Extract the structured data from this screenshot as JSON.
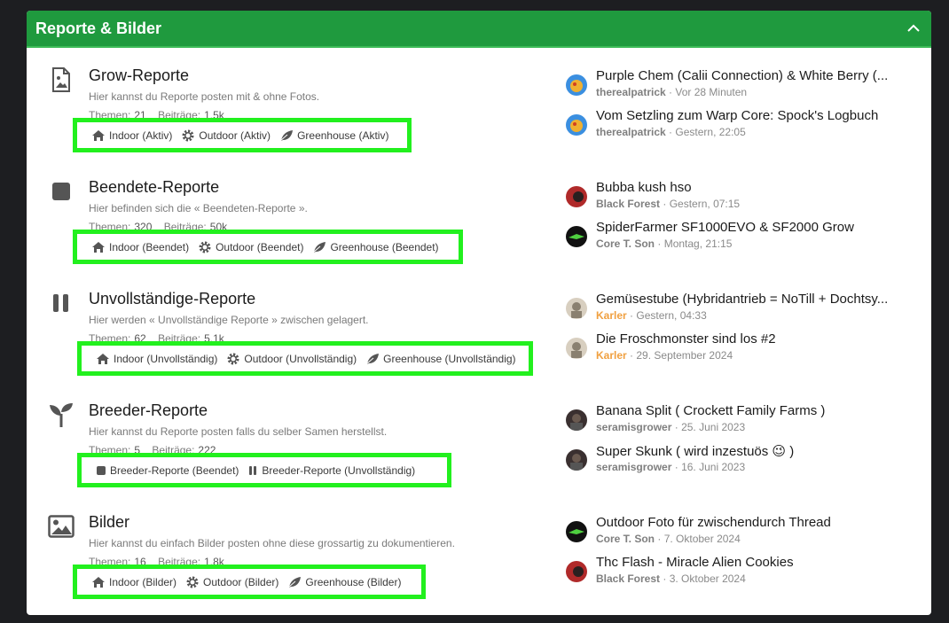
{
  "header": {
    "title": "Reporte & Bilder",
    "collapse_icon": "chevron-up-icon"
  },
  "colors": {
    "header_bg": "#1f9a3e",
    "highlight": "#22f01e",
    "orange_user": "#f0a040"
  },
  "nodes": [
    {
      "icon": "image-file-icon",
      "title": "Grow-Reporte",
      "desc": "Hier kannst du Reporte posten mit & ohne Fotos.",
      "stats": {
        "threads_label": "Themen:",
        "threads": "21",
        "posts_label": "Beiträge:",
        "posts": "1,5k"
      },
      "subs": [
        {
          "icon": "home-icon",
          "label": "Indoor (Aktiv)"
        },
        {
          "icon": "gear-icon",
          "label": "Outdoor (Aktiv)"
        },
        {
          "icon": "leaf-icon",
          "label": "Greenhouse (Aktiv)"
        }
      ]
    },
    {
      "icon": "stop-icon",
      "title": "Beendete-Reporte",
      "desc": "Hier befinden sich die « Beendeten-Reporte ».",
      "stats": {
        "threads_label": "Themen:",
        "threads": "320",
        "posts_label": "Beiträge:",
        "posts": "50k"
      },
      "subs": [
        {
          "icon": "home-icon",
          "label": "Indoor (Beendet)"
        },
        {
          "icon": "gear-icon",
          "label": "Outdoor (Beendet)"
        },
        {
          "icon": "leaf-icon",
          "label": "Greenhouse (Beendet)"
        }
      ]
    },
    {
      "icon": "pause-icon",
      "title": "Unvollständige-Reporte",
      "desc": "Hier werden « Unvollständige Reporte » zwischen gelagert.",
      "stats": {
        "threads_label": "Themen:",
        "threads": "62",
        "posts_label": "Beiträge:",
        "posts": "5,1k"
      },
      "subs": [
        {
          "icon": "home-icon",
          "label": "Indoor (Unvollständig)"
        },
        {
          "icon": "gear-icon",
          "label": "Outdoor (Unvollständig)"
        },
        {
          "icon": "leaf-icon",
          "label": "Greenhouse (Unvollständig)"
        }
      ]
    },
    {
      "icon": "seedling-icon",
      "title": "Breeder-Reporte",
      "desc": "Hier kannst du Reporte posten falls du selber Samen herstellst.",
      "stats": {
        "threads_label": "Themen:",
        "threads": "5",
        "posts_label": "Beiträge:",
        "posts": "222"
      },
      "subs": [
        {
          "icon": "stop-icon",
          "label": "Breeder-Reporte (Beendet)"
        },
        {
          "icon": "pause-icon",
          "label": "Breeder-Reporte (Unvollständig)"
        }
      ]
    },
    {
      "icon": "image-icon",
      "title": "Bilder",
      "desc": "Hier kannst du einfach Bilder posten ohne diese grossartig zu dokumentieren.",
      "stats": {
        "threads_label": "Themen:",
        "threads": "16",
        "posts_label": "Beiträge:",
        "posts": "1,8k"
      },
      "subs": [
        {
          "icon": "home-icon",
          "label": "Indoor (Bilder)"
        },
        {
          "icon": "gear-icon",
          "label": "Outdoor (Bilder)"
        },
        {
          "icon": "leaf-icon",
          "label": "Greenhouse (Bilder)"
        }
      ]
    }
  ],
  "posts": [
    {
      "title": "Purple Chem (Calii Connection) & White Berry (...",
      "user": "therealpatrick",
      "time": "Vor 28 Minuten",
      "avatar_color": "#3b8fe0"
    },
    {
      "title": "Vom Setzling zum Warp Core: Spock's Logbuch",
      "user": "therealpatrick",
      "time": "Gestern, 22:05",
      "avatar_color": "#3b8fe0"
    },
    {
      "title": "Bubba kush hso",
      "user": "Black Forest",
      "time": "Gestern, 07:15",
      "avatar_color": "#b02a2a"
    },
    {
      "title": "SpiderFarmer SF1000EVO & SF2000 Grow",
      "user": "Core T. Son",
      "time": "Montag, 21:15",
      "avatar_color": "#111111"
    },
    {
      "title": "Gemüsestube (Hybridantrieb = NoTill + Dochtsy...",
      "user": "Karler",
      "time": "Gestern, 04:33",
      "avatar_color": "#d8cfc0"
    },
    {
      "title": "Die Froschmonster sind los #2",
      "user": "Karler",
      "time": "29. September 2024",
      "avatar_color": "#d8cfc0"
    },
    {
      "title": "Banana Split ( Crockett Family Farms )",
      "user": "seramisgrower",
      "time": "25. Juni 2023",
      "avatar_color": "#3a3030"
    },
    {
      "title": "Super Skunk ( wird inzestuös 😉 )",
      "user": "seramisgrower",
      "time": "16. Juni 2023",
      "avatar_color": "#3a3030"
    },
    {
      "title": "Outdoor Foto für zwischendurch Thread",
      "user": "Core T. Son",
      "time": "7. Oktober 2024",
      "avatar_color": "#111111"
    },
    {
      "title": "Thc Flash - Miracle Alien Cookies",
      "user": "Black Forest",
      "time": "3. Oktober 2024",
      "avatar_color": "#b02a2a"
    }
  ],
  "separator": "·"
}
